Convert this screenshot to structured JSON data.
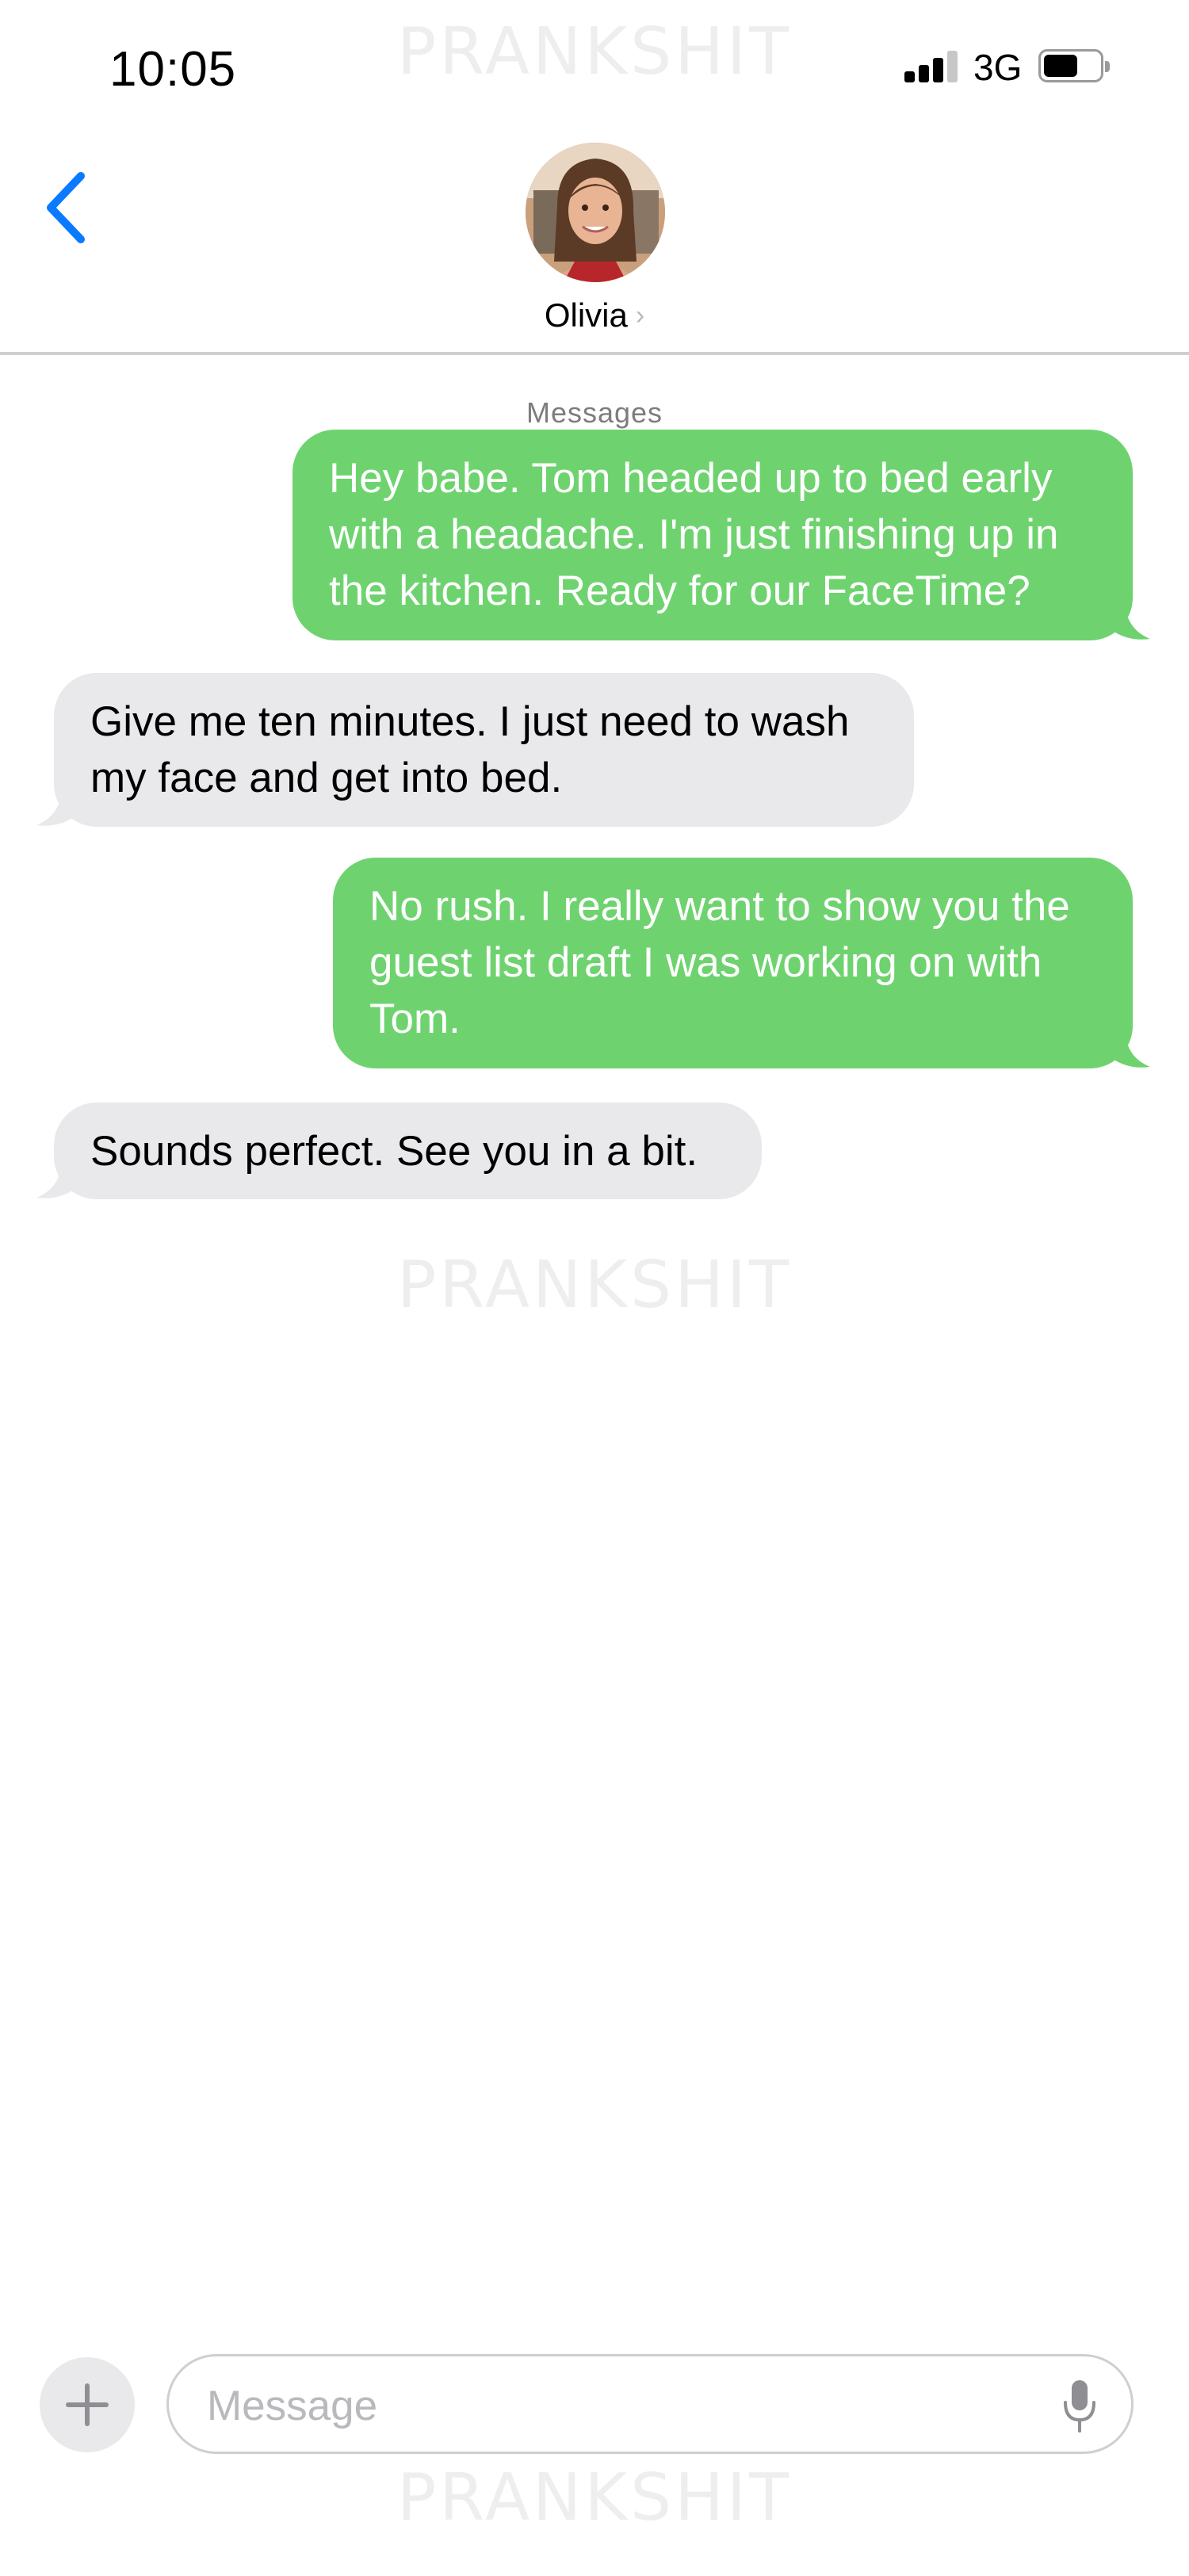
{
  "watermark": {
    "text": "PRANKSHIT"
  },
  "status_bar": {
    "time": "10:05",
    "network": "3G",
    "battery_level": 0.6,
    "signal_bars": 3
  },
  "header": {
    "contact_name": "Olivia",
    "back_icon": "chevron-left-icon",
    "info_icon": "chevron-right-icon"
  },
  "conversation": {
    "service_label": "Messages",
    "messages": [
      {
        "direction": "sent",
        "text": "Hey babe. Tom headed up to bed early with a headache. I'm just finishing up in the kitchen. Ready for our FaceTime?"
      },
      {
        "direction": "received",
        "text": "Give me ten minutes. I just need to wash my face and get into bed."
      },
      {
        "direction": "sent",
        "text": "No rush. I really want to show you the guest list draft I was working on with Tom."
      },
      {
        "direction": "received",
        "text": "Sounds perfect. See you in a bit."
      }
    ]
  },
  "composer": {
    "placeholder": "Message",
    "add_icon": "plus-icon",
    "mic_icon": "microphone-icon"
  },
  "colors": {
    "accent": "#0a7aff",
    "sent_bubble": "#6ed36f",
    "received_bubble": "#e9e9eb"
  }
}
